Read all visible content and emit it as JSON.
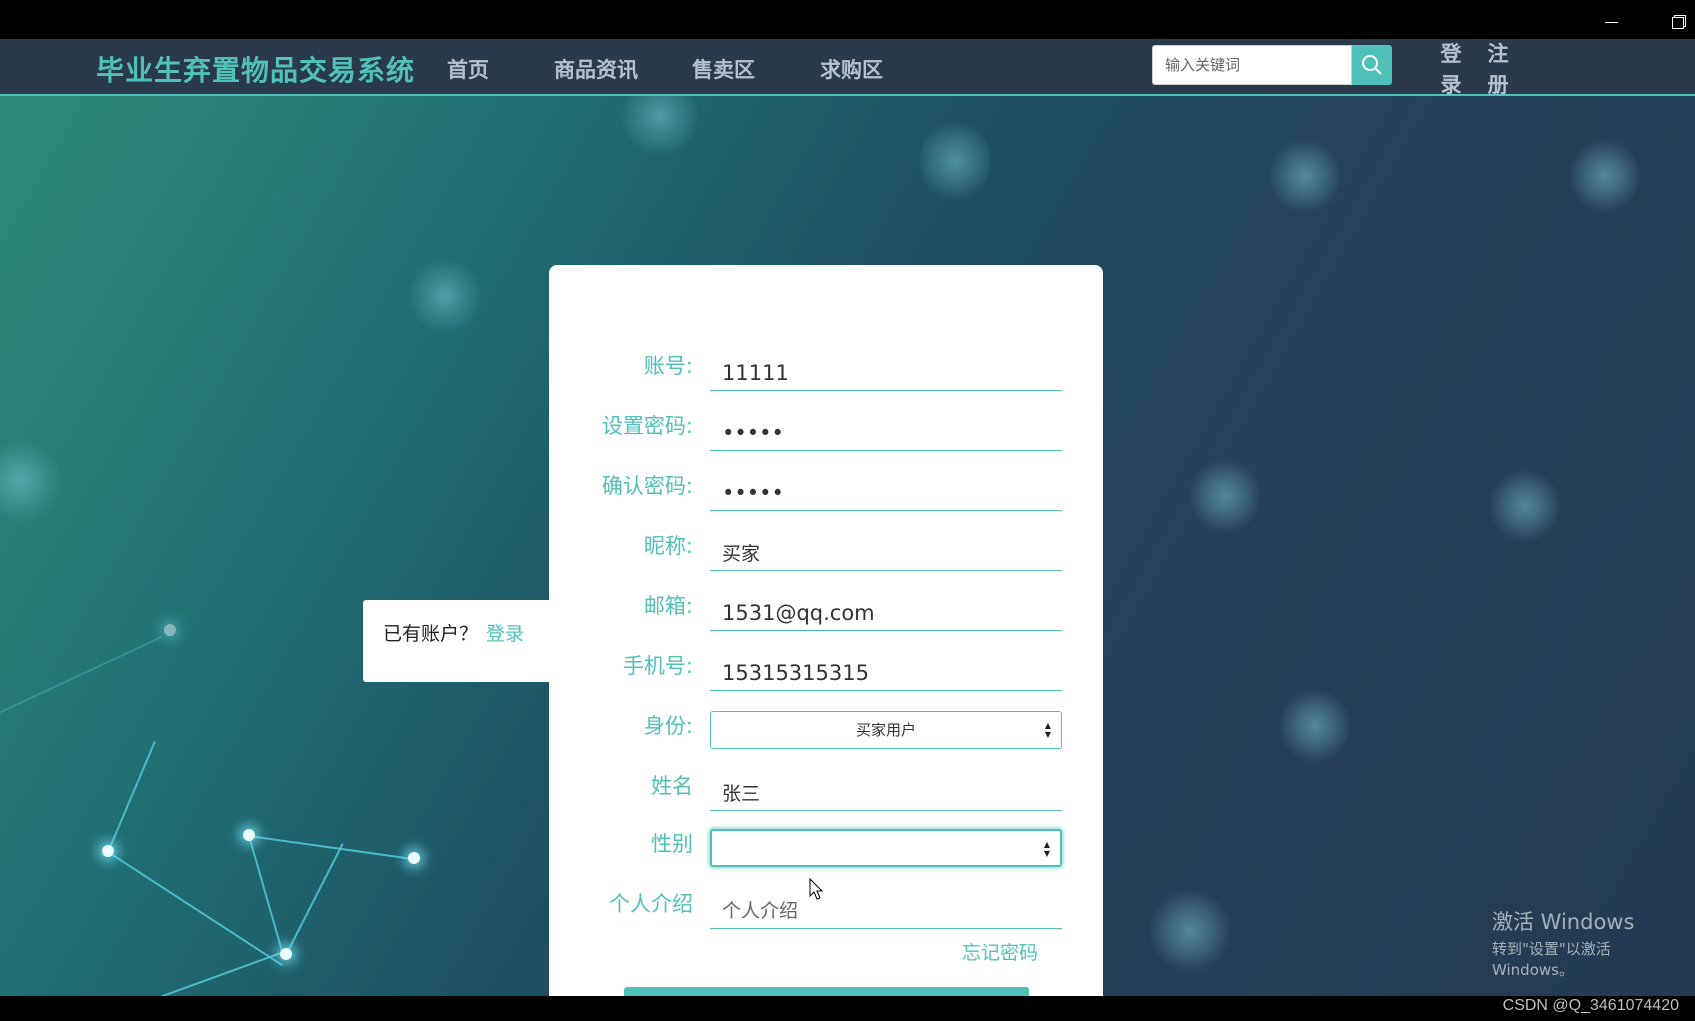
{
  "window": {
    "minimize_label": "",
    "restore_label": ""
  },
  "navbar": {
    "brand": "毕业生弃置物品交易系统",
    "items": [
      "首页",
      "商品资讯",
      "售卖区",
      "求购区"
    ],
    "search_placeholder": "输入关键词",
    "login_chars": [
      "登",
      "录"
    ],
    "register_chars": [
      "注",
      "册"
    ]
  },
  "login_prompt": {
    "question": "已有账户？",
    "link": "登录"
  },
  "form": {
    "account": {
      "label": "账号:",
      "value": "11111"
    },
    "password": {
      "label": "设置密码:",
      "value": "•••••"
    },
    "confirm_password": {
      "label": "确认密码:",
      "value": "•••••"
    },
    "nickname": {
      "label": "昵称:",
      "value": "买家"
    },
    "email": {
      "label": "邮箱:",
      "value": "1531@qq.com"
    },
    "phone": {
      "label": "手机号:",
      "value": "15315315315"
    },
    "identity": {
      "label": "身份:",
      "value": "买家用户"
    },
    "name": {
      "label": "姓名",
      "value": "张三"
    },
    "gender": {
      "label": "性别",
      "value": ""
    },
    "intro": {
      "label": "个人介绍",
      "placeholder": "个人介绍"
    },
    "forgot": "忘记密码"
  },
  "watermark": {
    "line1": "激活 Windows",
    "line2": "转到\"设置\"以激活 Windows。"
  },
  "credit": "CSDN @Q_3461074420",
  "colors": {
    "accent": "#4fc1b9",
    "navbar": "#2b3a4a"
  }
}
